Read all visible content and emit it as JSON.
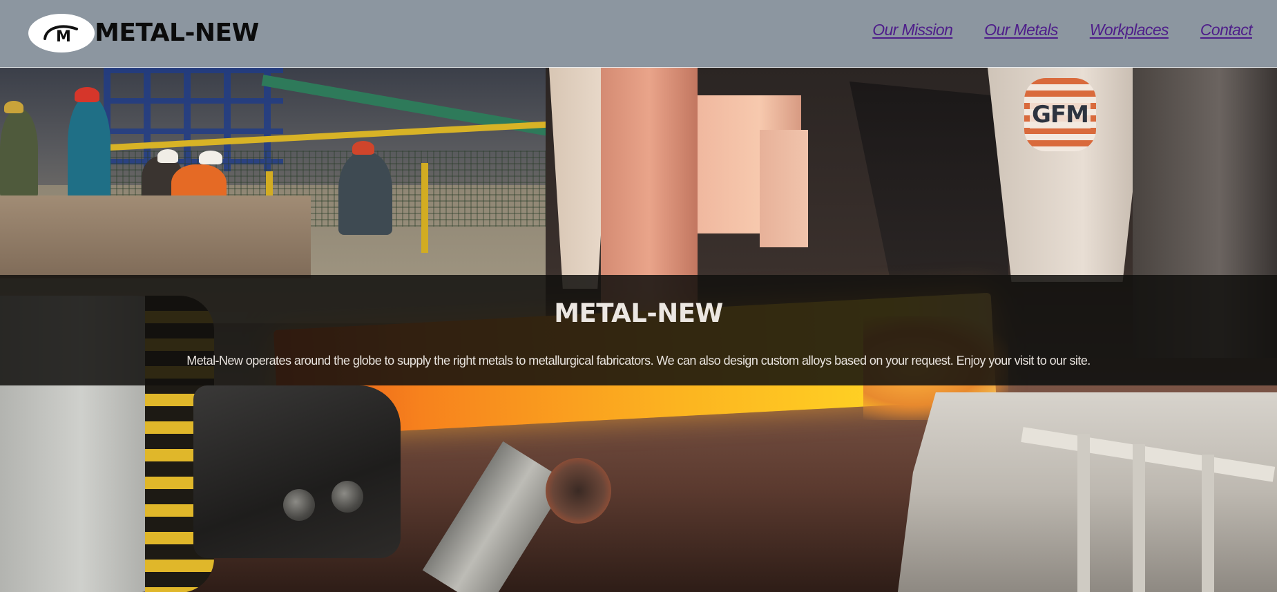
{
  "header": {
    "brand": "METAL-NEW",
    "logo": {
      "icon": "m-monogram-logo",
      "monogram": "M"
    },
    "background_color": "#8c96a0",
    "nav": [
      {
        "label": "Our Mission"
      },
      {
        "label": "Our Metals"
      },
      {
        "label": "Workplaces"
      },
      {
        "label": "Contact"
      }
    ],
    "link_color": "#4e1d8a"
  },
  "hero": {
    "image": "steel-mill-hot-metal-bar-scene",
    "machine_badge": "GFM",
    "band": {
      "title": "METAL-NEW",
      "text": "Metal-New operates around the globe to supply the right metals to metallurgical fabricators. We can also design custom alloys based on your request. Enjoy your visit to our site."
    }
  }
}
